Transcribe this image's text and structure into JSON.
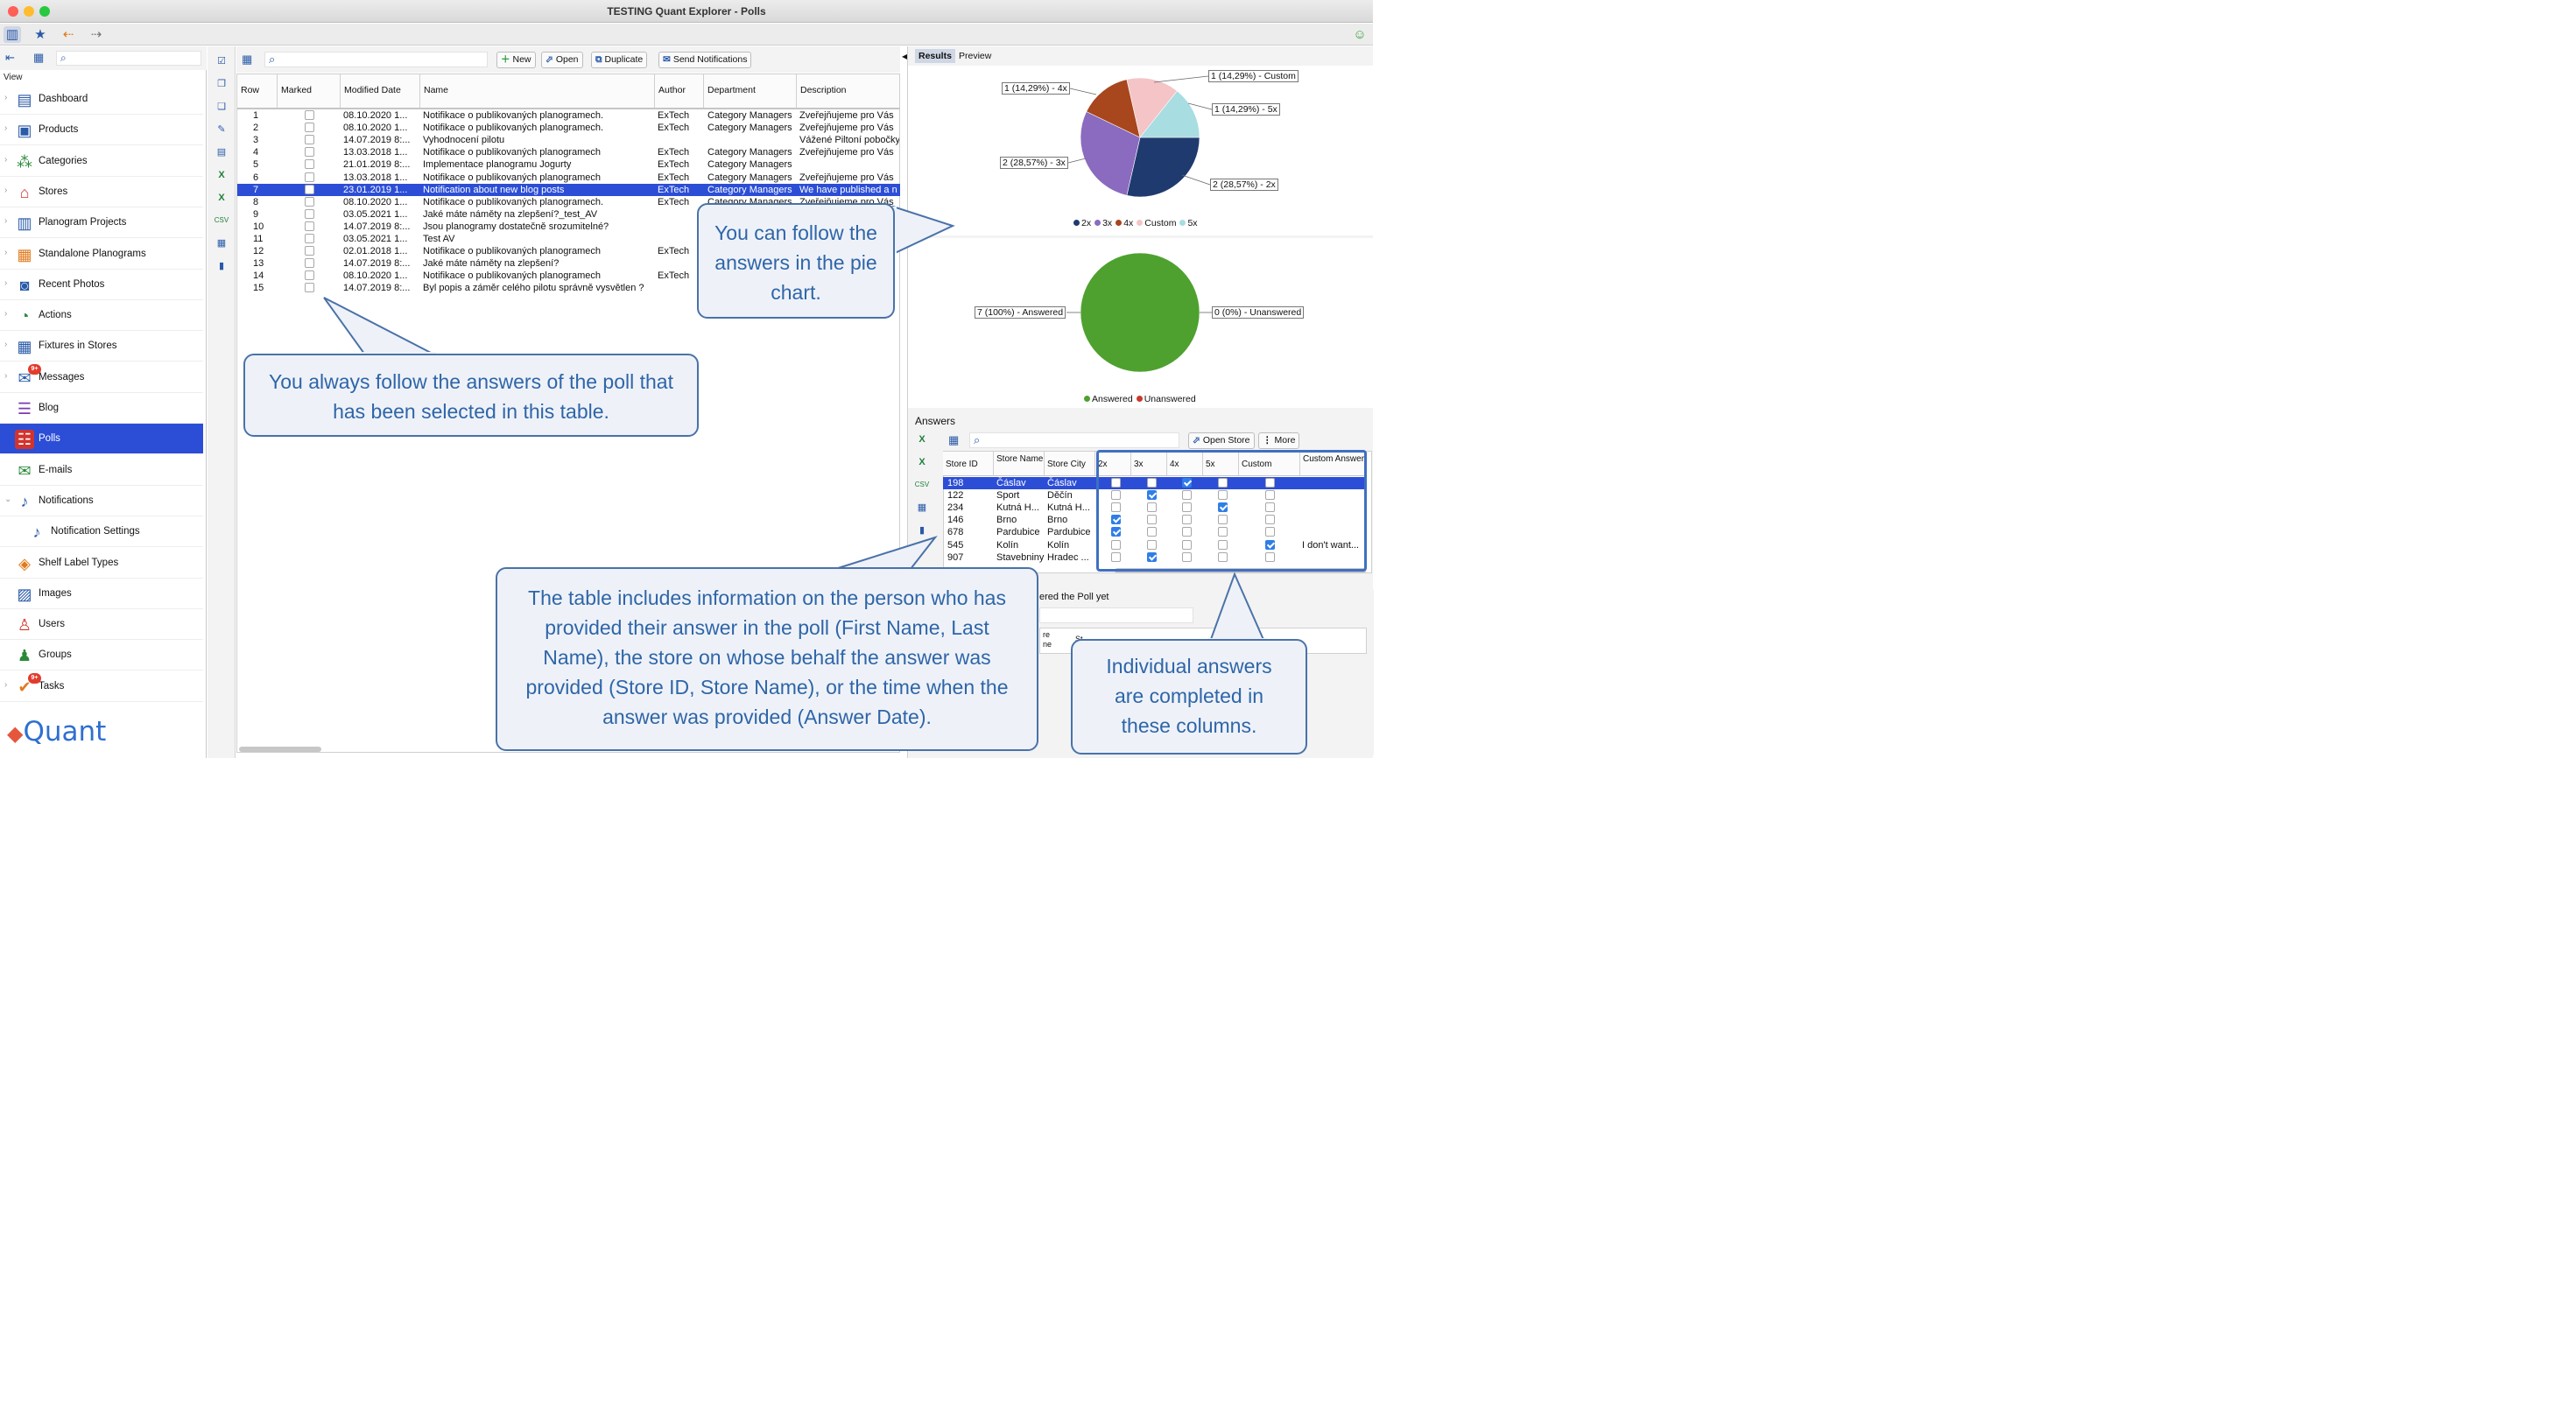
{
  "window": {
    "title": "TESTING Quant Explorer - Polls"
  },
  "sidebar": {
    "view_label": "View",
    "items": [
      {
        "label": "Dashboard"
      },
      {
        "label": "Products"
      },
      {
        "label": "Categories"
      },
      {
        "label": "Stores"
      },
      {
        "label": "Planogram Projects"
      },
      {
        "label": "Standalone Planograms"
      },
      {
        "label": "Recent Photos"
      },
      {
        "label": "Actions"
      },
      {
        "label": "Fixtures in Stores"
      },
      {
        "label": "Messages",
        "badge": "9+"
      },
      {
        "label": "Blog"
      },
      {
        "label": "Polls"
      },
      {
        "label": "E-mails"
      },
      {
        "label": "Notifications"
      },
      {
        "label": "Notification Settings"
      },
      {
        "label": "Shelf Label Types"
      },
      {
        "label": "Images"
      },
      {
        "label": "Users"
      },
      {
        "label": "Groups"
      },
      {
        "label": "Tasks",
        "badge": "9+"
      }
    ],
    "logo": "Quant"
  },
  "polls_toolbar": {
    "new": "New",
    "open": "Open",
    "duplicate": "Duplicate",
    "send": "Send Notifications"
  },
  "polls_table": {
    "columns": [
      "Row",
      "Marked",
      "Modified Date",
      "Name",
      "Author",
      "Department",
      "Description"
    ],
    "rows": [
      [
        "1",
        "08.10.2020 1...",
        "Notifikace o publikovaných planogramech.",
        "ExTech",
        "Category Managers",
        "Zveřejňujeme pro Vás"
      ],
      [
        "2",
        "08.10.2020 1...",
        "Notifikace o publikovaných planogramech.",
        "ExTech",
        "Category Managers",
        "Zveřejňujeme pro Vás"
      ],
      [
        "3",
        "14.07.2019 8:...",
        "Vyhodnocení pilotu",
        "",
        "",
        "Vážené Piltoní pobočky"
      ],
      [
        "4",
        "13.03.2018 1...",
        "Notifikace o publikovaných planogramech",
        "ExTech",
        "Category Managers",
        "Zveřejňujeme pro Vás"
      ],
      [
        "5",
        "21.01.2019 8:...",
        "Implementace planogramu Jogurty",
        "ExTech",
        "Category Managers",
        ""
      ],
      [
        "6",
        "13.03.2018 1...",
        "Notifikace o publikovaných planogramech",
        "ExTech",
        "Category Managers",
        "Zveřejňujeme pro Vás"
      ],
      [
        "7",
        "23.01.2019 1...",
        "Notification about new blog posts",
        "ExTech",
        "Category Managers",
        "We have published a n"
      ],
      [
        "8",
        "08.10.2020 1...",
        "Notifikace o publikovaných planogramech.",
        "ExTech",
        "Category Managers",
        "Zveřejňujeme pro Vás"
      ],
      [
        "9",
        "03.05.2021 1...",
        "Jaké máte náměty na zlepšení?_test_AV",
        "",
        "",
        "a"
      ],
      [
        "10",
        "14.07.2019 8:...",
        "Jsou planogramy dostatečně srozumitelné?",
        "",
        "",
        "a"
      ],
      [
        "11",
        "03.05.2021 1...",
        "Test AV",
        "",
        "",
        ""
      ],
      [
        "12",
        "02.01.2018 1...",
        "Notifikace o publikovaných planogramech",
        "ExTech",
        "",
        "a"
      ],
      [
        "13",
        "14.07.2019 8:...",
        "Jaké máte náměty na zlepšení?",
        "",
        "",
        "a"
      ],
      [
        "14",
        "08.10.2020 1...",
        "Notifikace o publikovaných planogramech",
        "ExTech",
        "",
        "a"
      ],
      [
        "15",
        "14.07.2019 8:...",
        "Byl popis a záměr celého pilotu správně vysvětlen ?",
        "",
        "",
        ""
      ]
    ],
    "selected_row": 7
  },
  "results": {
    "tabs": [
      "Results",
      "Preview"
    ],
    "pie1_labels": {
      "x4": "1 (14,29%) - 4x",
      "custom": "1 (14,29%) - Custom",
      "x5": "1 (14,29%) - 5x",
      "x3": "2 (28,57%) - 3x",
      "x2": "2 (28,57%) - 2x"
    },
    "pie1_legend": [
      "2x",
      "3x",
      "4x",
      "Custom",
      "5x"
    ],
    "pie2_labels": {
      "answered": "7 (100%) - Answered",
      "unanswered": "0 (0%) - Unanswered"
    },
    "pie2_legend": [
      "Answered",
      "Unanswered"
    ]
  },
  "chart_data": [
    {
      "type": "pie",
      "categories": [
        "2x",
        "3x",
        "4x",
        "Custom",
        "5x"
      ],
      "values": [
        2,
        2,
        1,
        1,
        1
      ],
      "colors": [
        "#1f3a6e",
        "#8a6bbf",
        "#a8461e",
        "#f4c4c7",
        "#a8dde2"
      ]
    },
    {
      "type": "pie",
      "categories": [
        "Answered",
        "Unanswered"
      ],
      "values": [
        7,
        0
      ],
      "colors": [
        "#4ea12f",
        "#c9392c"
      ]
    }
  ],
  "answers": {
    "title": "Answers",
    "open_store": "Open Store",
    "more": "More",
    "columns": [
      "Store ID",
      "Store Name",
      "Store City",
      "2x",
      "3x",
      "4x",
      "5x",
      "Custom",
      "Custom Answer"
    ],
    "rows": [
      {
        "id": "198",
        "name": "Čáslav",
        "city": "Čáslav",
        "checks": [
          0,
          0,
          1,
          0,
          0
        ],
        "custom": ""
      },
      {
        "id": "122",
        "name": "Sport",
        "city": "Děčín",
        "checks": [
          0,
          1,
          0,
          0,
          0
        ],
        "custom": ""
      },
      {
        "id": "234",
        "name": "Kutná H...",
        "city": "Kutná H...",
        "checks": [
          0,
          0,
          0,
          1,
          0
        ],
        "custom": ""
      },
      {
        "id": "146",
        "name": "Brno",
        "city": "Brno",
        "checks": [
          1,
          0,
          0,
          0,
          0
        ],
        "custom": ""
      },
      {
        "id": "678",
        "name": "Pardubice",
        "city": "Pardubice",
        "checks": [
          1,
          0,
          0,
          0,
          0
        ],
        "custom": ""
      },
      {
        "id": "545",
        "name": "Kolín",
        "city": "Kolín",
        "checks": [
          0,
          0,
          0,
          0,
          1
        ],
        "custom": "I don't want..."
      },
      {
        "id": "907",
        "name": "Stavebniny",
        "city": "Hradec ...",
        "checks": [
          0,
          1,
          0,
          0,
          0
        ],
        "custom": ""
      }
    ],
    "not_answered_title": "ered the Poll yet",
    "not_answered_cols": [
      "re\nne",
      "St"
    ]
  },
  "annotations": {
    "pie": "You can follow the answers in the pie chart.",
    "table": "You always follow the answers of the poll that has been selected in this table.",
    "info": "The table includes information on the person who has provided their answer in the poll (First Name, Last Name), the store on whose behalf the answer was provided (Store ID, Store Name), or the time when the answer was provided (Answer Date).",
    "columns": "Individual answers are completed in these columns."
  },
  "colors": {
    "accent": "#2c4ed6",
    "bubble_border": "#4a72a8",
    "bubble_text": "#2f65a8"
  }
}
